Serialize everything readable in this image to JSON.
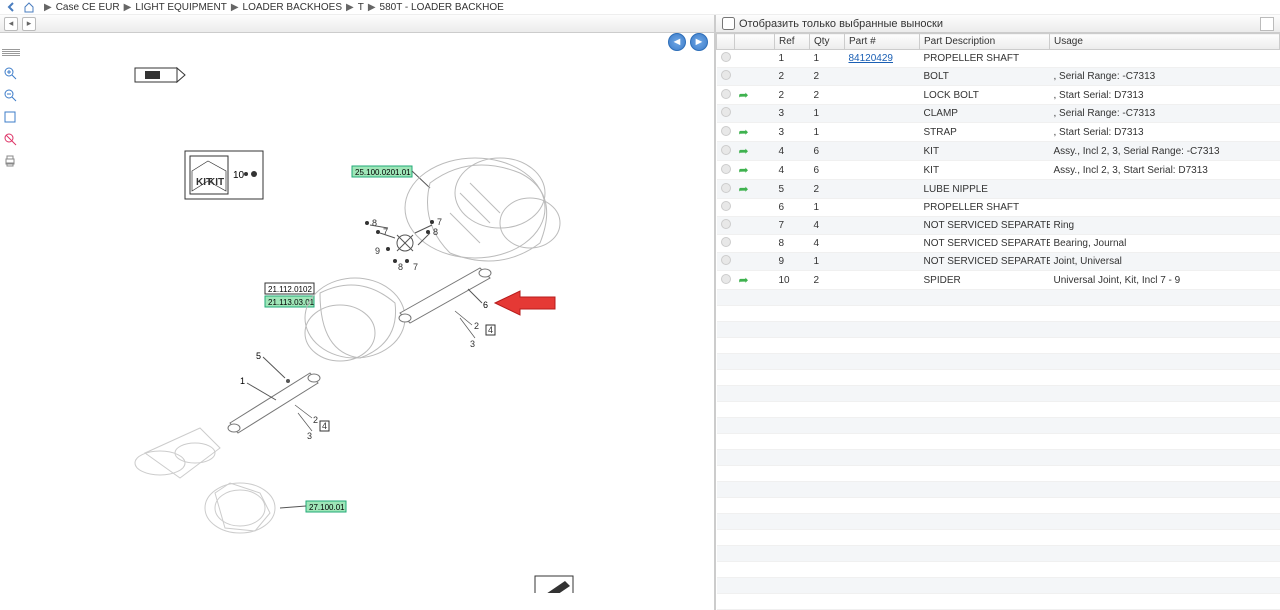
{
  "breadcrumb": {
    "items": [
      "Case CE EUR",
      "LIGHT EQUIPMENT",
      "LOADER BACKHOES",
      "T",
      "580T - LOADER BACKHOE"
    ]
  },
  "right_header": {
    "checkbox_label": "Отобразить только выбранные выноски"
  },
  "table": {
    "headers": {
      "ref": "Ref",
      "qty": "Qty",
      "part": "Part #",
      "desc": "Part Description",
      "usage": "Usage"
    },
    "rows": [
      {
        "flag": false,
        "ref": "1",
        "qty": "1",
        "part": "84120429",
        "part_link": true,
        "desc": "PROPELLER SHAFT",
        "usage": ""
      },
      {
        "flag": false,
        "ref": "2",
        "qty": "2",
        "part": "",
        "desc": "BOLT",
        "usage": ", Serial Range: -C7313"
      },
      {
        "flag": true,
        "ref": "2",
        "qty": "2",
        "part": "",
        "desc": "LOCK BOLT",
        "usage": ", Start Serial: D7313"
      },
      {
        "flag": false,
        "ref": "3",
        "qty": "1",
        "part": "",
        "desc": "CLAMP",
        "usage": ", Serial Range: -C7313"
      },
      {
        "flag": true,
        "ref": "3",
        "qty": "1",
        "part": "",
        "desc": "STRAP",
        "usage": ", Start Serial: D7313"
      },
      {
        "flag": true,
        "ref": "4",
        "qty": "6",
        "part": "",
        "desc": "KIT",
        "usage": "Assy., Incl 2, 3, Serial Range: -C7313"
      },
      {
        "flag": true,
        "ref": "4",
        "qty": "6",
        "part": "",
        "desc": "KIT",
        "usage": "Assy., Incl 2, 3, Start Serial: D7313"
      },
      {
        "flag": true,
        "ref": "5",
        "qty": "2",
        "part": "",
        "desc": "LUBE NIPPLE",
        "usage": ""
      },
      {
        "flag": false,
        "ref": "6",
        "qty": "1",
        "part": "",
        "desc": "PROPELLER SHAFT",
        "usage": ""
      },
      {
        "flag": false,
        "ref": "7",
        "qty": "4",
        "part": "",
        "desc": "NOT SERVICED SEPARATELY",
        "usage": "Ring"
      },
      {
        "flag": false,
        "ref": "8",
        "qty": "4",
        "part": "",
        "desc": "NOT SERVICED SEPARATELY",
        "usage": "Bearing, Journal"
      },
      {
        "flag": false,
        "ref": "9",
        "qty": "1",
        "part": "",
        "desc": "NOT SERVICED SEPARATELY",
        "usage": "Joint, Universal"
      },
      {
        "flag": true,
        "ref": "10",
        "qty": "2",
        "part": "",
        "desc": "SPIDER",
        "usage": "Universal Joint, Kit, Incl 7 - 9"
      }
    ]
  },
  "diagram": {
    "kit_label": "10",
    "tags": {
      "green_top": "25.100.0201.01",
      "white_box": "21.112.0102",
      "green_mid": "21.113.03.01",
      "green_bottom": "27.100.01"
    },
    "callouts": [
      "1",
      "2",
      "3",
      "4",
      "5",
      "6",
      "7",
      "8",
      "9"
    ]
  }
}
